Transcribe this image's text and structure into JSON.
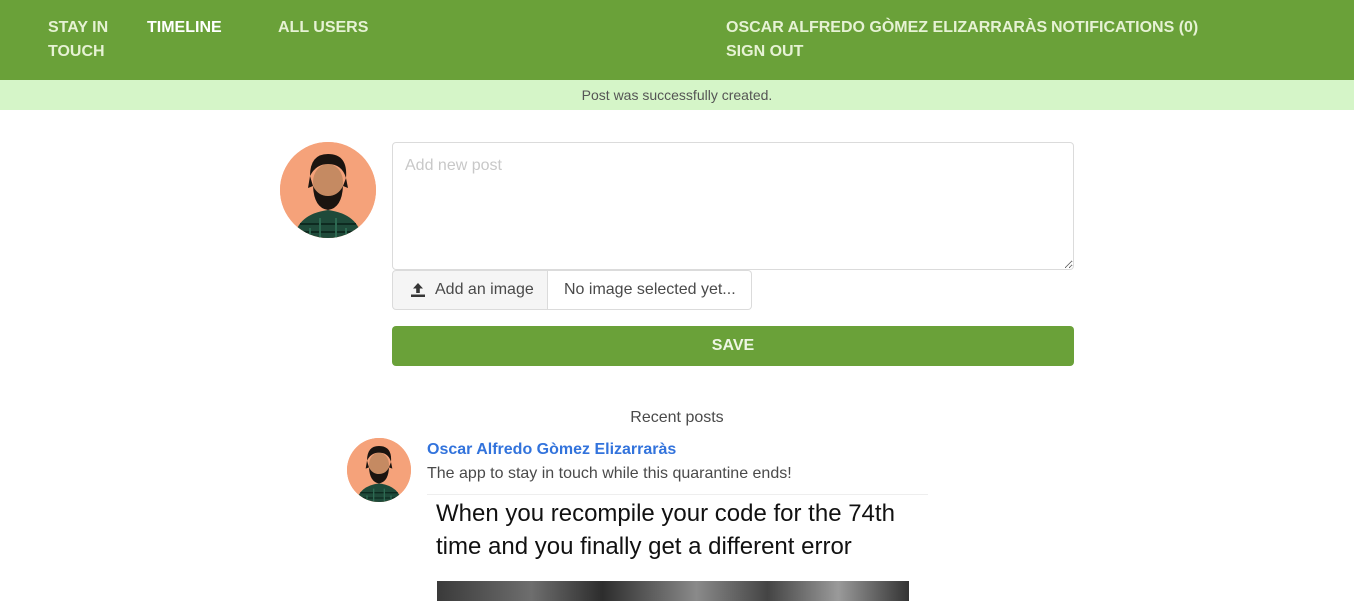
{
  "navbar": {
    "brand": "STAY IN TOUCH",
    "timeline": "TIMELINE",
    "all_users": "ALL USERS",
    "profile": "OSCAR ALFREDO GÒMEZ ELIZARRARÀS",
    "notifications": "NOTIFICATIONS (0)",
    "sign_out": "SIGN OUT",
    "color": "#6aa139"
  },
  "flash": {
    "message": "Post was successfully created.",
    "color": "#d5f5c8"
  },
  "new_post": {
    "placeholder": "Add new post",
    "add_image_label": "Add an image",
    "file_name": "No image selected yet...",
    "save_label": "SAVE"
  },
  "recent": {
    "title": "Recent posts",
    "posts": [
      {
        "author": "Oscar Alfredo Gòmez Elizarraràs",
        "body": "The app to stay in touch while this quarantine ends!",
        "image_caption": "When you recompile your code for the 74th time and you finally get a different error"
      }
    ]
  },
  "colors": {
    "accent": "#6aa139",
    "link": "#3273dc"
  },
  "icons": {
    "upload": "upload-icon"
  }
}
